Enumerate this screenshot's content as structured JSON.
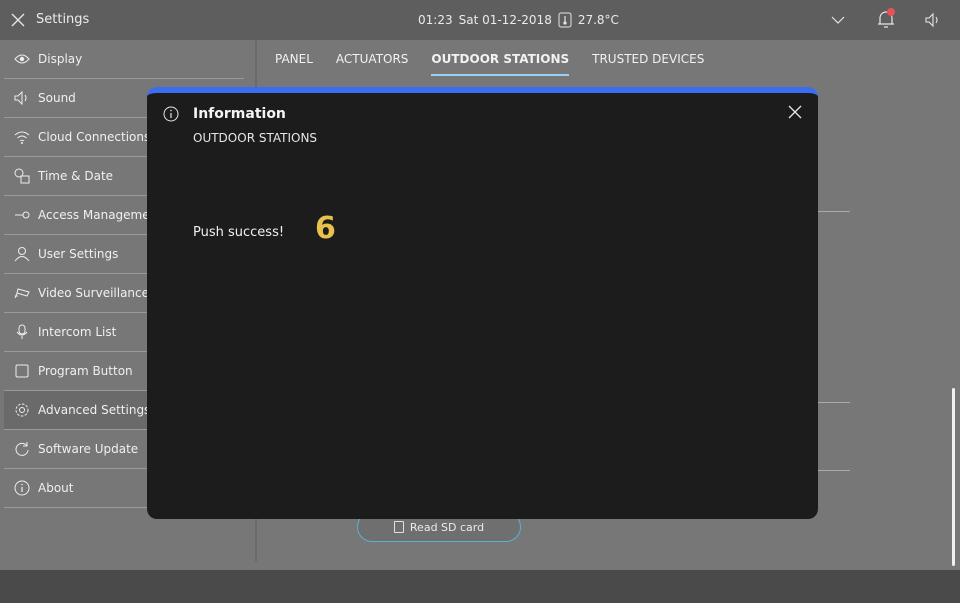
{
  "topbar": {
    "title": "Settings",
    "time": "01:23",
    "date": "Sat 01-12-2018",
    "temperature": "27.8°C",
    "notification_dot_color": "#e8505a"
  },
  "sidebar": {
    "items": [
      {
        "label": "Display",
        "icon": "eye-icon"
      },
      {
        "label": "Sound",
        "icon": "speaker-icon"
      },
      {
        "label": "Cloud Connections",
        "icon": "wifi-icon"
      },
      {
        "label": "Time & Date",
        "icon": "clock-calendar-icon"
      },
      {
        "label": "Access Manageme",
        "icon": "key-icon"
      },
      {
        "label": "User Settings",
        "icon": "user-icon"
      },
      {
        "label": "Video Surveillance",
        "icon": "camera-icon"
      },
      {
        "label": "Intercom List",
        "icon": "microphone-icon"
      },
      {
        "label": "Program Button",
        "icon": "square-icon"
      },
      {
        "label": "Advanced Settings",
        "icon": "gear-icon",
        "active": true
      },
      {
        "label": "Software Update",
        "icon": "refresh-icon"
      },
      {
        "label": "About",
        "icon": "info-icon"
      }
    ]
  },
  "tabs": [
    {
      "label": "PANEL"
    },
    {
      "label": "ACTUATORS"
    },
    {
      "label": "OUTDOOR STATIONS",
      "active": true
    },
    {
      "label": "TRUSTED DEVICES"
    }
  ],
  "sd_button": {
    "label": "Read SD card"
  },
  "modal": {
    "title": "Information",
    "subtitle": "OUTDOOR STATIONS",
    "message": "Push success!",
    "badge_number": "6",
    "accent_color": "#3a6df0"
  }
}
